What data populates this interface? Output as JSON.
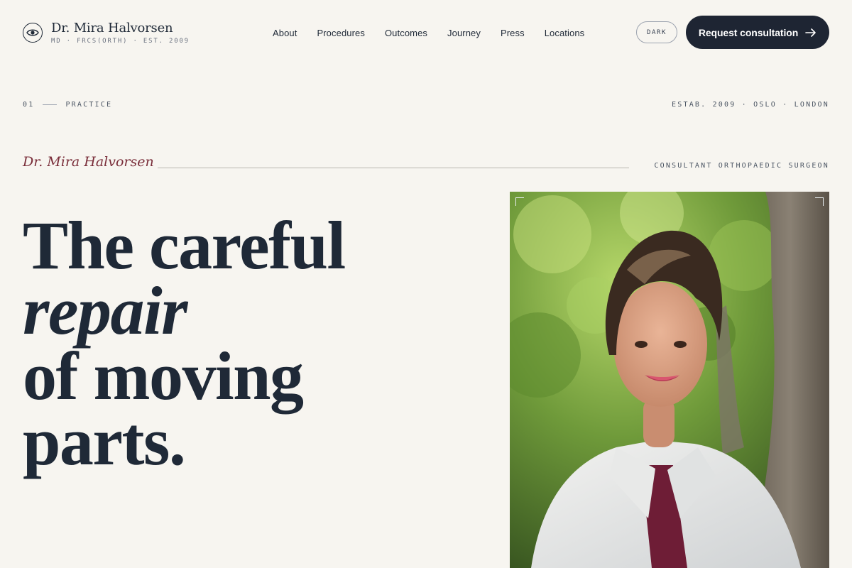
{
  "brand": {
    "name": "Dr. Mira Halvorsen",
    "credentials": "MD · FRCS(ORTH) · EST. 2009",
    "logo_icon": "eye-icon"
  },
  "nav": {
    "items": [
      {
        "label": "About"
      },
      {
        "label": "Procedures"
      },
      {
        "label": "Outcomes"
      },
      {
        "label": "Journey"
      },
      {
        "label": "Press"
      },
      {
        "label": "Locations"
      }
    ]
  },
  "header": {
    "theme_toggle_label": "DARK",
    "cta_label": "Request consultation",
    "cta_icon": "arrow-right-icon"
  },
  "section": {
    "number": "01",
    "label": "PRACTICE",
    "established": "ESTAB. 2009 · OSLO · LONDON"
  },
  "hero": {
    "signature": "Dr. Mira Halvorsen",
    "role": "CONSULTANT ORTHOPAEDIC SURGEON",
    "headline": {
      "line1": "The careful",
      "line2": "repair",
      "line3": "of moving",
      "line4": "parts."
    }
  },
  "colors": {
    "background": "#f7f5f0",
    "ink": "#1f2937",
    "accent": "#7a2e3a",
    "cta_bg": "#1e2533"
  }
}
